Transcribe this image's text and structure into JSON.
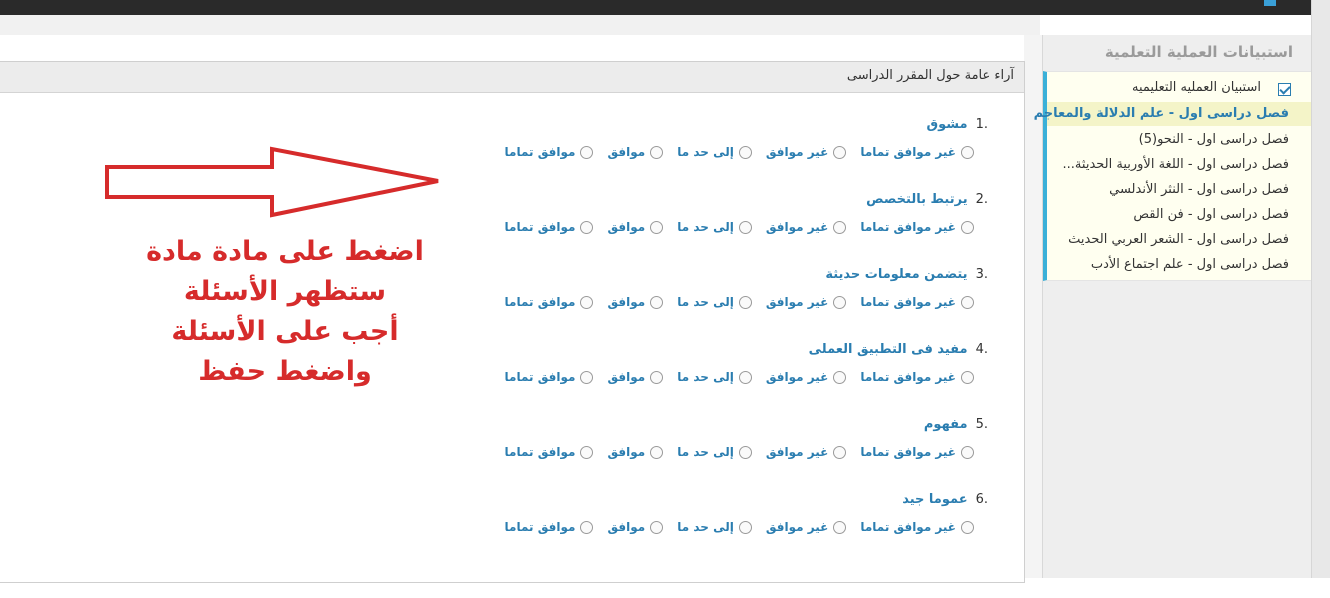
{
  "sidebar": {
    "title": "استبيانات العملية التعلمية",
    "head": "استبيان العمليه التعليميه",
    "active": "فصل دراسى اول - علم الدلالة والمعاجم",
    "items": [
      "فصل دراسى اول - النحو(5)",
      "فصل دراسى اول - اللغة الأوربية الحديثة...",
      "فصل دراسى اول - النثر الأندلسي",
      "فصل دراسى اول - فن القص",
      "فصل دراسى اول - الشعر العربي الحديث",
      "فصل دراسى اول - علم اجتماع الأدب"
    ]
  },
  "panel": {
    "title": "آراء عامة حول المقرر الدراسى"
  },
  "options": [
    "غير موافق تماما",
    "غير موافق",
    "إلى حد ما",
    "موافق",
    "موافق تماما"
  ],
  "questions": [
    {
      "num": ".1",
      "text": "مشوق"
    },
    {
      "num": ".2",
      "text": "يرتبط بالتخصص"
    },
    {
      "num": ".3",
      "text": "يتضمن معلومات حديثة"
    },
    {
      "num": ".4",
      "text": "مفيد فى التطبيق العملى"
    },
    {
      "num": ".5",
      "text": "مفهوم"
    },
    {
      "num": ".6",
      "text": "عموما جيد"
    }
  ],
  "instructions": {
    "line1": "اضغط على مادة مادة",
    "line2": "ستظهر الأسئلة",
    "line3": "أجب على الأسئلة",
    "line4": "واضغط حفظ"
  },
  "colors": {
    "accent": "#2a7db0",
    "annotation": "#d62b2b"
  }
}
